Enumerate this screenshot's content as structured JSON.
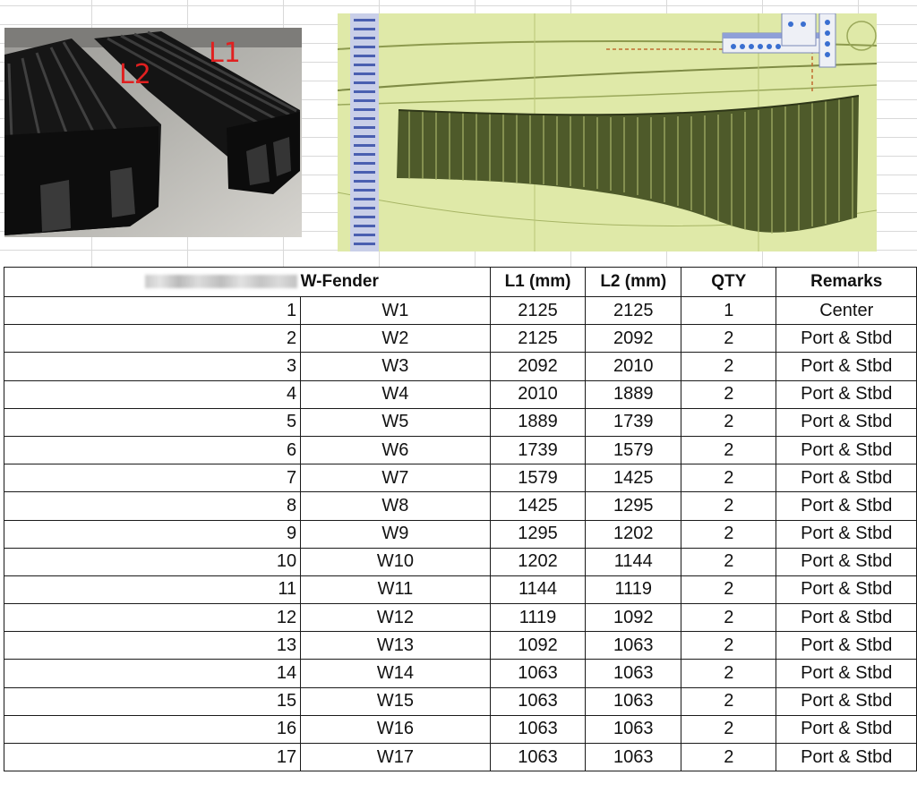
{
  "photo": {
    "annotation_l1": "L1",
    "annotation_l2": "L2"
  },
  "table": {
    "header": {
      "title": "W-Fender",
      "l1": "L1 (mm)",
      "l2": "L2 (mm)",
      "qty": "QTY",
      "remarks": "Remarks"
    },
    "rows": [
      {
        "no": "1",
        "id": "W1",
        "l1": "2125",
        "l2": "2125",
        "qty": "1",
        "remarks": "Center"
      },
      {
        "no": "2",
        "id": "W2",
        "l1": "2125",
        "l2": "2092",
        "qty": "2",
        "remarks": "Port & Stbd"
      },
      {
        "no": "3",
        "id": "W3",
        "l1": "2092",
        "l2": "2010",
        "qty": "2",
        "remarks": "Port & Stbd"
      },
      {
        "no": "4",
        "id": "W4",
        "l1": "2010",
        "l2": "1889",
        "qty": "2",
        "remarks": "Port & Stbd"
      },
      {
        "no": "5",
        "id": "W5",
        "l1": "1889",
        "l2": "1739",
        "qty": "2",
        "remarks": "Port & Stbd"
      },
      {
        "no": "6",
        "id": "W6",
        "l1": "1739",
        "l2": "1579",
        "qty": "2",
        "remarks": "Port & Stbd"
      },
      {
        "no": "7",
        "id": "W7",
        "l1": "1579",
        "l2": "1425",
        "qty": "2",
        "remarks": "Port & Stbd"
      },
      {
        "no": "8",
        "id": "W8",
        "l1": "1425",
        "l2": "1295",
        "qty": "2",
        "remarks": "Port & Stbd"
      },
      {
        "no": "9",
        "id": "W9",
        "l1": "1295",
        "l2": "1202",
        "qty": "2",
        "remarks": "Port & Stbd"
      },
      {
        "no": "10",
        "id": "W10",
        "l1": "1202",
        "l2": "1144",
        "qty": "2",
        "remarks": "Port & Stbd"
      },
      {
        "no": "11",
        "id": "W11",
        "l1": "1144",
        "l2": "1119",
        "qty": "2",
        "remarks": "Port & Stbd"
      },
      {
        "no": "12",
        "id": "W12",
        "l1": "1119",
        "l2": "1092",
        "qty": "2",
        "remarks": "Port & Stbd"
      },
      {
        "no": "13",
        "id": "W13",
        "l1": "1092",
        "l2": "1063",
        "qty": "2",
        "remarks": "Port & Stbd"
      },
      {
        "no": "14",
        "id": "W14",
        "l1": "1063",
        "l2": "1063",
        "qty": "2",
        "remarks": "Port & Stbd"
      },
      {
        "no": "15",
        "id": "W15",
        "l1": "1063",
        "l2": "1063",
        "qty": "2",
        "remarks": "Port & Stbd"
      },
      {
        "no": "16",
        "id": "W16",
        "l1": "1063",
        "l2": "1063",
        "qty": "2",
        "remarks": "Port & Stbd"
      },
      {
        "no": "17",
        "id": "W17",
        "l1": "1063",
        "l2": "1063",
        "qty": "2",
        "remarks": "Port & Stbd"
      }
    ]
  }
}
